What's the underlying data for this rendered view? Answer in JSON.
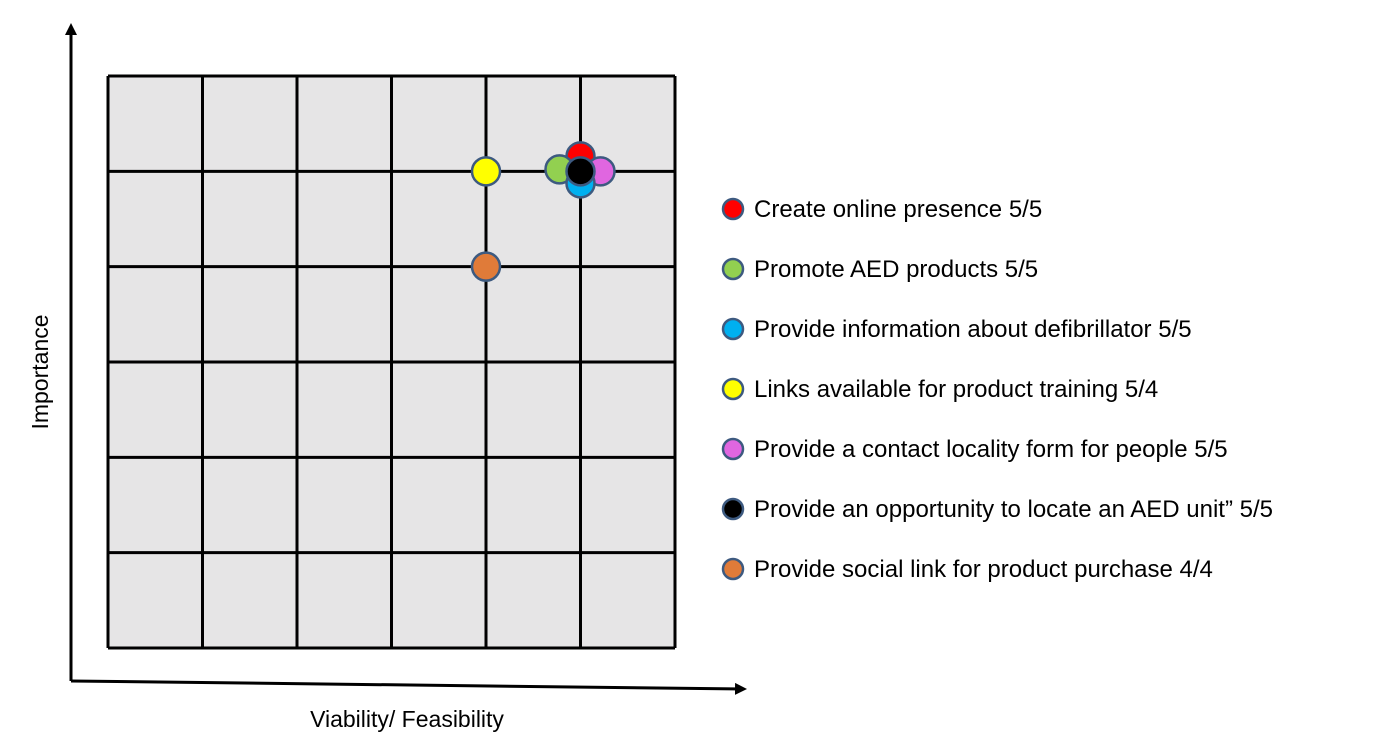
{
  "chart_data": {
    "type": "scatter",
    "title": "",
    "xlabel": "Viability/ Feasibility",
    "ylabel": "Importance",
    "xlim": [
      0,
      6
    ],
    "ylim": [
      0,
      6
    ],
    "grid": true,
    "legend_position": "right",
    "series": [
      {
        "name": "Create online presence 5/5",
        "x": 5,
        "y": 5,
        "color": "#ff0000"
      },
      {
        "name": "Promote AED products 5/5",
        "x": 5,
        "y": 5,
        "color": "#92d050"
      },
      {
        "name": "Provide information about defibrillator 5/5",
        "x": 5,
        "y": 5,
        "color": "#00b0f0"
      },
      {
        "name": "Links available for product training 5/4",
        "x": 4,
        "y": 5,
        "color": "#ffff00"
      },
      {
        "name": "Provide a contact locality form for people 5/5",
        "x": 5,
        "y": 5,
        "color": "#e066e0"
      },
      {
        "name": "Provide an opportunity to locate an AED unit” 5/5",
        "x": 5,
        "y": 5,
        "color": "#000000"
      },
      {
        "name": "Provide social link for product purchase 4/4",
        "x": 4,
        "y": 4,
        "color": "#e07b39"
      }
    ]
  }
}
